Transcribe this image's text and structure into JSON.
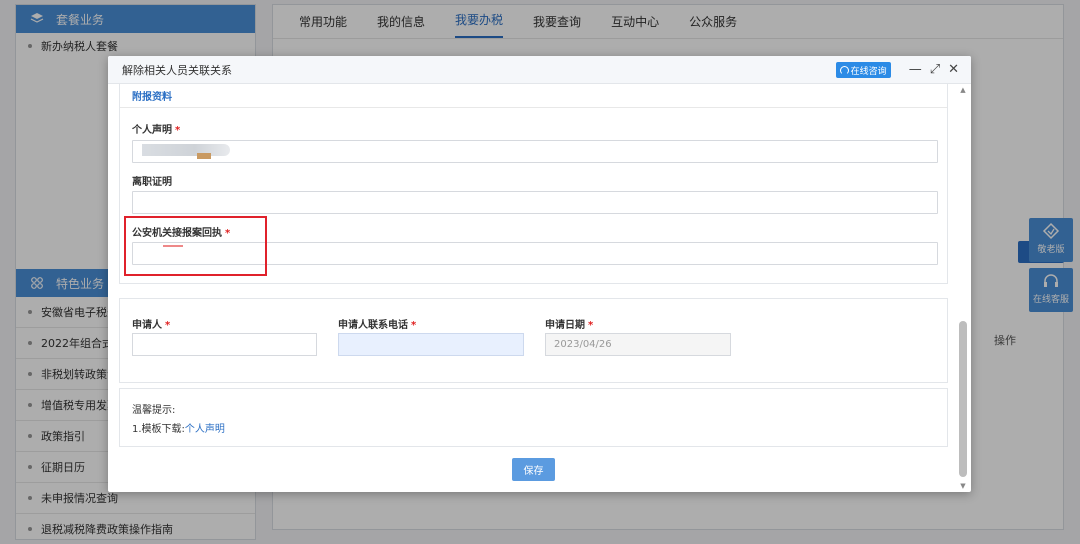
{
  "left_panel": {
    "package_title": "套餐业务",
    "package_items": [
      "新办纳税人套餐"
    ],
    "special_title": "特色业务",
    "special_items": [
      "安徽省电子税务",
      "2022年组合式",
      "非税划转政策专",
      "增值税专用发票",
      "政策指引",
      "征期日历",
      "未申报情况查询",
      "退税减税降费政策操作指南"
    ]
  },
  "main_tabs": [
    "常用功能",
    "我的信息",
    "我要办税",
    "我要查询",
    "互动中心",
    "公众服务"
  ],
  "main_active_tab": 2,
  "bg_table_op_header": "操作",
  "side_float": {
    "elder": "敬老版",
    "service": "在线客服"
  },
  "modal": {
    "title": "解除相关人员关联关系",
    "consult_label": "在线咨询",
    "attach_section_title": "附报资料",
    "fields": {
      "personal_statement": "个人声明",
      "resignation_cert": "离职证明",
      "police_receipt": "公安机关接报案回执"
    },
    "applicant": {
      "name_label": "申请人",
      "phone_label": "申请人联系电话",
      "date_label": "申请日期",
      "date_value": "2023/04/26"
    },
    "tips": {
      "title": "温馨提示:",
      "line_prefix": "1.模板下载:",
      "link": "个人声明"
    },
    "save_label": "保存"
  },
  "colors": {
    "brand_blue": "#4a8fd8",
    "link_blue": "#2b6fc4",
    "required_red": "#e02020",
    "highlight_red": "#e0212b"
  }
}
